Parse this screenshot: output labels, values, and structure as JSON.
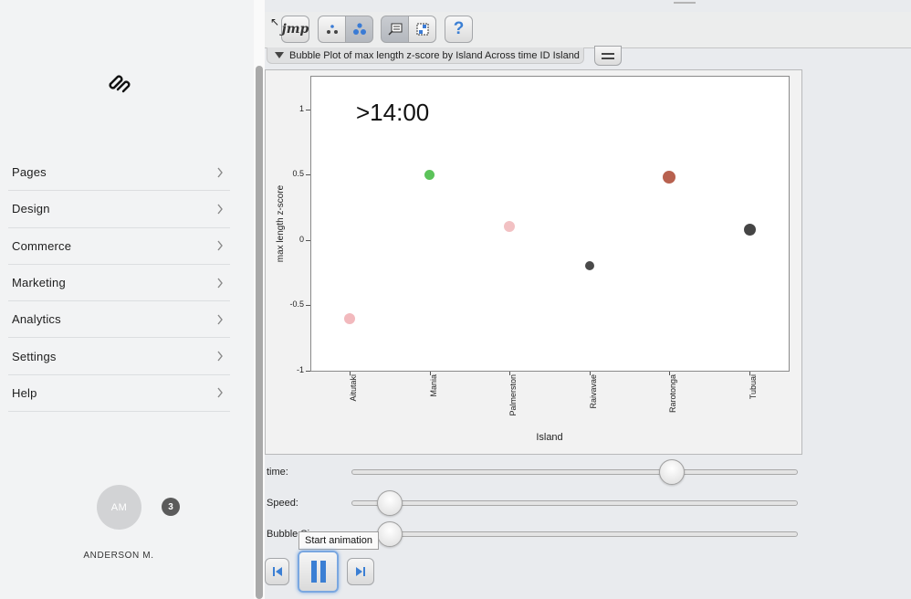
{
  "sidebar": {
    "items": [
      {
        "label": "Pages"
      },
      {
        "label": "Design"
      },
      {
        "label": "Commerce"
      },
      {
        "label": "Marketing"
      },
      {
        "label": "Analytics"
      },
      {
        "label": "Settings"
      },
      {
        "label": "Help"
      }
    ],
    "user": {
      "initials": "AM",
      "name": "ANDERSON M.",
      "notifications": "3"
    }
  },
  "toolbar": {
    "jmp_label": "jmp",
    "help_label": "?"
  },
  "report": {
    "outline_title": "Bubble Plot of max length z-score by Island Across time ID Island",
    "time_caption": ">14:00"
  },
  "chart_data": {
    "type": "scatter",
    "xlabel": "Island",
    "ylabel": "max length z-score",
    "categories": [
      "Aitutaki",
      "Mania",
      "Palmerston",
      "Raivavae",
      "Rarotonga",
      "Tubuai"
    ],
    "ylim": [
      -1,
      1.2
    ],
    "yticks": [
      {
        "v": 1,
        "label": "1"
      },
      {
        "v": 0.5,
        "label": "0.5"
      },
      {
        "v": 0,
        "label": "0"
      },
      {
        "v": -0.5,
        "label": "-0.5"
      },
      {
        "v": -1,
        "label": "-1"
      }
    ],
    "points": [
      {
        "category": "Aitutaki",
        "y": -0.6,
        "size": 12,
        "color": "#f2b9bd"
      },
      {
        "category": "Mania",
        "y": 0.5,
        "size": 11,
        "color": "#5cc35a"
      },
      {
        "category": "Palmerston",
        "y": 0.1,
        "size": 12,
        "color": "#f2c1c3"
      },
      {
        "category": "Raivavae",
        "y": -0.2,
        "size": 10,
        "color": "#4a4a4a"
      },
      {
        "category": "Rarotonga",
        "y": 0.48,
        "size": 14,
        "color": "#b8614f"
      },
      {
        "category": "Tubuai",
        "y": 0.08,
        "size": 13,
        "color": "#454545"
      }
    ],
    "grid": false
  },
  "controls": {
    "time_label": "time:",
    "speed_label": "Speed:",
    "bubble_label": "Bubble Si",
    "time_value": 0.73,
    "speed_value": 0.06,
    "bubble_value": 0.06,
    "tooltip": "Start animation"
  },
  "colors": {
    "accent": "#4a90e2",
    "sidebar_bg": "#f2f3f4"
  }
}
